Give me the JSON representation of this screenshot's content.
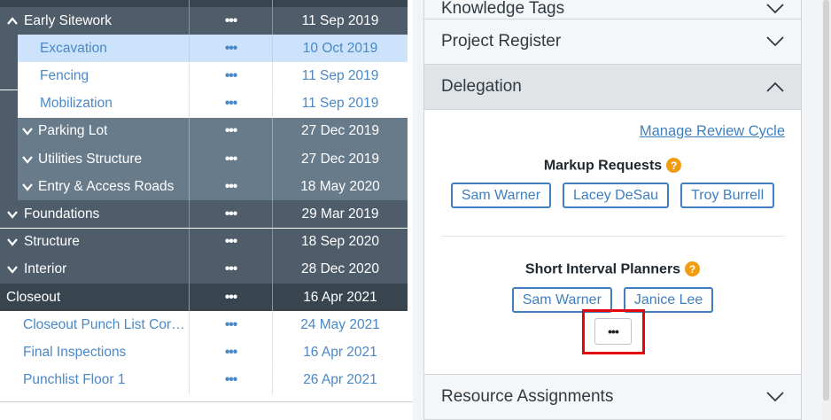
{
  "schedule": {
    "rows": [
      {
        "name": "Early Sitework",
        "dots": "•••",
        "date": "11 Sep 2019",
        "kind": "lv0",
        "chevron": "up"
      },
      {
        "name": "Excavation",
        "dots": "•••",
        "date": "10 Oct 2019",
        "kind": "leaf sel"
      },
      {
        "name": "Fencing",
        "dots": "•••",
        "date": "11 Sep 2019",
        "kind": "leaf"
      },
      {
        "name": "Mobilization",
        "dots": "•••",
        "date": "11 Sep 2019",
        "kind": "leaf"
      },
      {
        "name": "Parking Lot",
        "dots": "•••",
        "date": "27 Dec 2019",
        "kind": "lv1",
        "chevron": "down"
      },
      {
        "name": "Utilities Structure",
        "dots": "•••",
        "date": "27 Dec 2019",
        "kind": "lv1",
        "chevron": "down"
      },
      {
        "name": "Entry & Access Roads",
        "dots": "•••",
        "date": "18 May 2020",
        "kind": "lv1",
        "chevron": "down"
      },
      {
        "name": "Foundations",
        "dots": "•••",
        "date": "29 Mar 2019",
        "kind": "lv0",
        "chevron": "down"
      },
      {
        "name": "Structure",
        "dots": "•••",
        "date": "18 Sep 2020",
        "kind": "lv0",
        "chevron": "down"
      },
      {
        "name": "Interior",
        "dots": "•••",
        "date": "28 Dec 2020",
        "kind": "lv0",
        "chevron": "down"
      },
      {
        "name": "Closeout",
        "dots": "•••",
        "date": "16 Apr 2021",
        "kind": "dark"
      },
      {
        "name": "Closeout Punch List Corrections",
        "dots": "•••",
        "date": "24 May 2021",
        "kind": "sub"
      },
      {
        "name": "Final Inspections",
        "dots": "•••",
        "date": "16 Apr 2021",
        "kind": "sub"
      },
      {
        "name": "Punchlist Floor 1",
        "dots": "•••",
        "date": "26 Apr 2021",
        "kind": "sub"
      }
    ]
  },
  "panel": {
    "sections": {
      "knowledge_tags": "Knowledge Tags",
      "project_register": "Project Register",
      "delegation": "Delegation",
      "resource_assignments": "Resource Assignments"
    },
    "delegation": {
      "manage_link": "Manage Review Cycle",
      "markup_title": "Markup Requests",
      "markup_people": [
        "Sam Warner",
        "Lacey DeSau",
        "Troy Burrell"
      ],
      "planners_title": "Short Interval Planners",
      "planner_people": [
        "Sam Warner",
        "Janice Lee"
      ],
      "help_glyph": "?",
      "more_label": "•••"
    }
  },
  "colors": {
    "accent": "#3f7fbf",
    "help": "#f39c12",
    "highlight": "#e3060a",
    "selected_row": "#cce3fb"
  }
}
